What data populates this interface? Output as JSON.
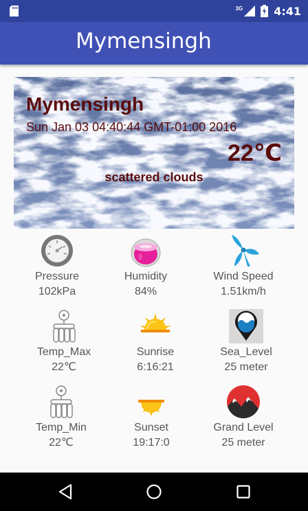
{
  "status_bar": {
    "network": "3G",
    "time": "4:41",
    "icons": [
      "sd-card-icon",
      "signal-icon",
      "battery-charging-icon"
    ]
  },
  "app_bar": {
    "title": "Mymensingh"
  },
  "weather": {
    "city": "Mymensingh",
    "datetime": "Sun Jan 03 04:40:44 GMT-01:00 2016",
    "temperature": "22℃",
    "description": "scattered clouds"
  },
  "details": [
    {
      "icon": "pressure-gauge-icon",
      "label": "Pressure",
      "value": "102kPa"
    },
    {
      "icon": "humidity-icon",
      "label": "Humidity",
      "value": "84%"
    },
    {
      "icon": "wind-turbine-icon",
      "label": "Wind Speed",
      "value": "1.51km/h"
    },
    {
      "icon": "thermometer-max-icon",
      "label": "Temp_Max",
      "value": "22℃"
    },
    {
      "icon": "sunrise-icon",
      "label": "Sunrise",
      "value": "6:16:21"
    },
    {
      "icon": "sea-level-icon",
      "label": "Sea_Level",
      "value": "25 meter"
    },
    {
      "icon": "thermometer-min-icon",
      "label": "Temp_Min",
      "value": "22℃"
    },
    {
      "icon": "sunset-icon",
      "label": "Sunset",
      "value": "19:17:0"
    },
    {
      "icon": "grand-level-icon",
      "label": "Grand Level",
      "value": "25 meter"
    }
  ],
  "colors": {
    "status_bar": "#2f439c",
    "app_bar": "#3f51b5",
    "weather_text": "#5a0c0c",
    "detail_text": "#555555"
  }
}
